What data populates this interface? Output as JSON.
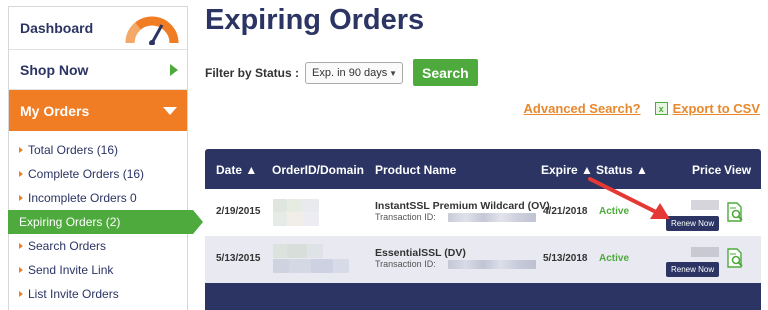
{
  "sidebar": {
    "dashboard": "Dashboard",
    "shop_now": "Shop Now",
    "my_orders": "My Orders",
    "items": [
      {
        "label": "Total Orders (16)"
      },
      {
        "label": "Complete Orders (16)"
      },
      {
        "label": "Incomplete Orders 0"
      },
      {
        "label": "Expiring Orders (2)"
      },
      {
        "label": "Search Orders"
      },
      {
        "label": "Send Invite Link"
      },
      {
        "label": "List Invite Orders"
      }
    ]
  },
  "page": {
    "title": "Expiring Orders",
    "filter_label": "Filter by Status :",
    "filter_value": "Exp. in 90 days",
    "search_button": "Search",
    "advanced_search": "Advanced Search?",
    "export_csv": "Export to CSV"
  },
  "table": {
    "headers": {
      "date": "Date ▲",
      "order": "OrderID/Domain",
      "product": "Product Name",
      "expire": "Expire ▲",
      "status": "Status ▲",
      "price": "Price",
      "view": "View"
    },
    "rows": [
      {
        "date": "2/19/2015",
        "product": "InstantSSL Premium Wildcard (OV)",
        "transaction": "Transaction ID:",
        "expire": "4/21/2018",
        "status": "Active",
        "renew": "Renew Now"
      },
      {
        "date": "5/13/2015",
        "product": "EssentialSSL (DV)",
        "transaction": "Transaction ID:",
        "expire": "5/13/2018",
        "status": "Active",
        "renew": "Renew Now"
      }
    ]
  },
  "colors": {
    "navy": "#2b3463",
    "orange": "#f07c24",
    "green": "#4eaa3c",
    "arrow_red": "#e53935"
  },
  "icons": [
    "speedometer-icon",
    "chevron-right-icon",
    "chevron-down-icon",
    "csv-file-icon",
    "view-details-icon"
  ]
}
